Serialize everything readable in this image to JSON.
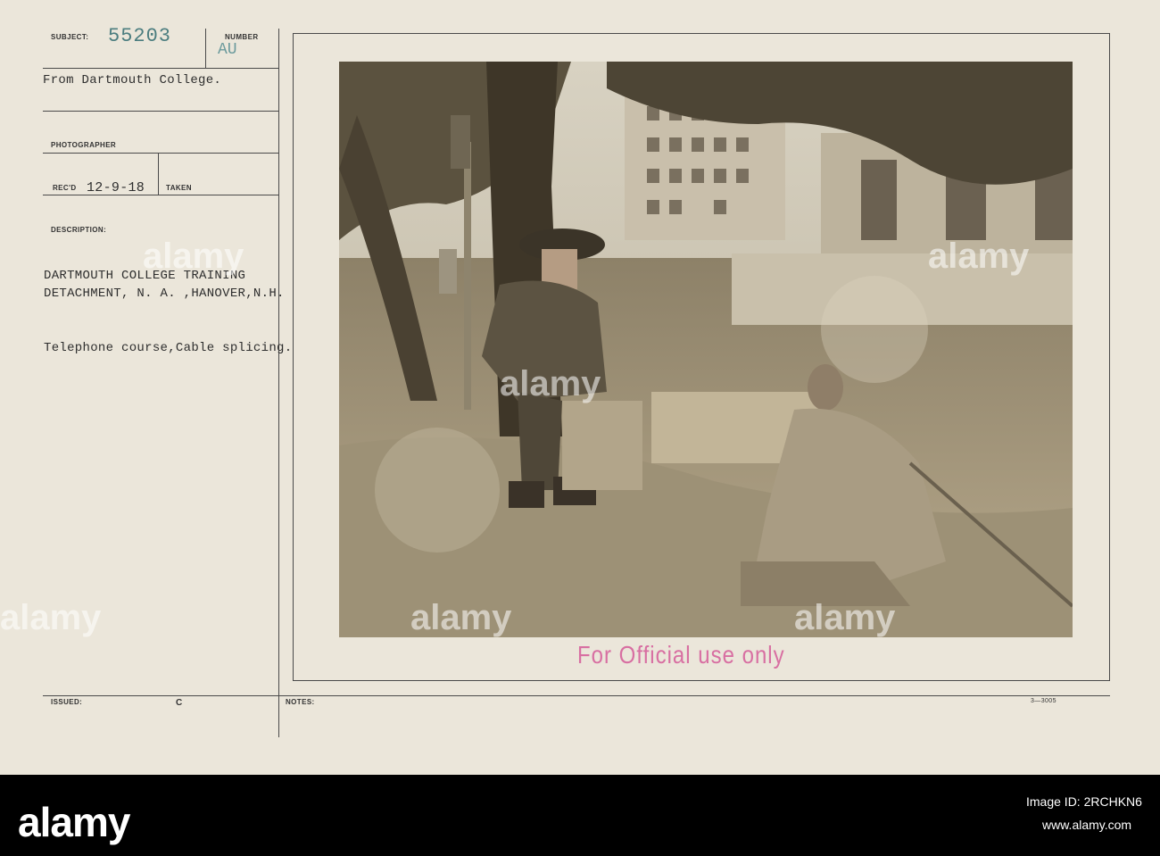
{
  "labels": {
    "subject": "SUBJECT:",
    "number": "NUMBER",
    "photographer": "PHOTOGRAPHER",
    "recd": "REC'D",
    "taken": "TAKEN",
    "description": "DESCRIPTION:",
    "issued": "ISSUED:",
    "notes": "NOTES:"
  },
  "stamps": {
    "subject_number": "55203",
    "number_code": "AU",
    "official": "For Official use only"
  },
  "card": {
    "source": "From Dartmouth College.",
    "recd_date": "12-9-18",
    "description_line1": "DARTMOUTH COLLEGE TRAINING",
    "description_line2": "DETACHMENT, N. A. ,HANOVER,N.H.",
    "caption": "Telephone course,Cable splicing.",
    "issued_mark": "C",
    "form_number": "3—3005"
  },
  "watermark": {
    "brand": "alamy",
    "image_id_label": "Image ID: 2RCHKN6",
    "url": "www.alamy.com",
    "side_id": "2RCHKN6"
  },
  "colors": {
    "card": "#ebe6da",
    "stamp_teal": "#4b7d7f",
    "official_pink": "#d86fa2",
    "band": "#000000"
  }
}
